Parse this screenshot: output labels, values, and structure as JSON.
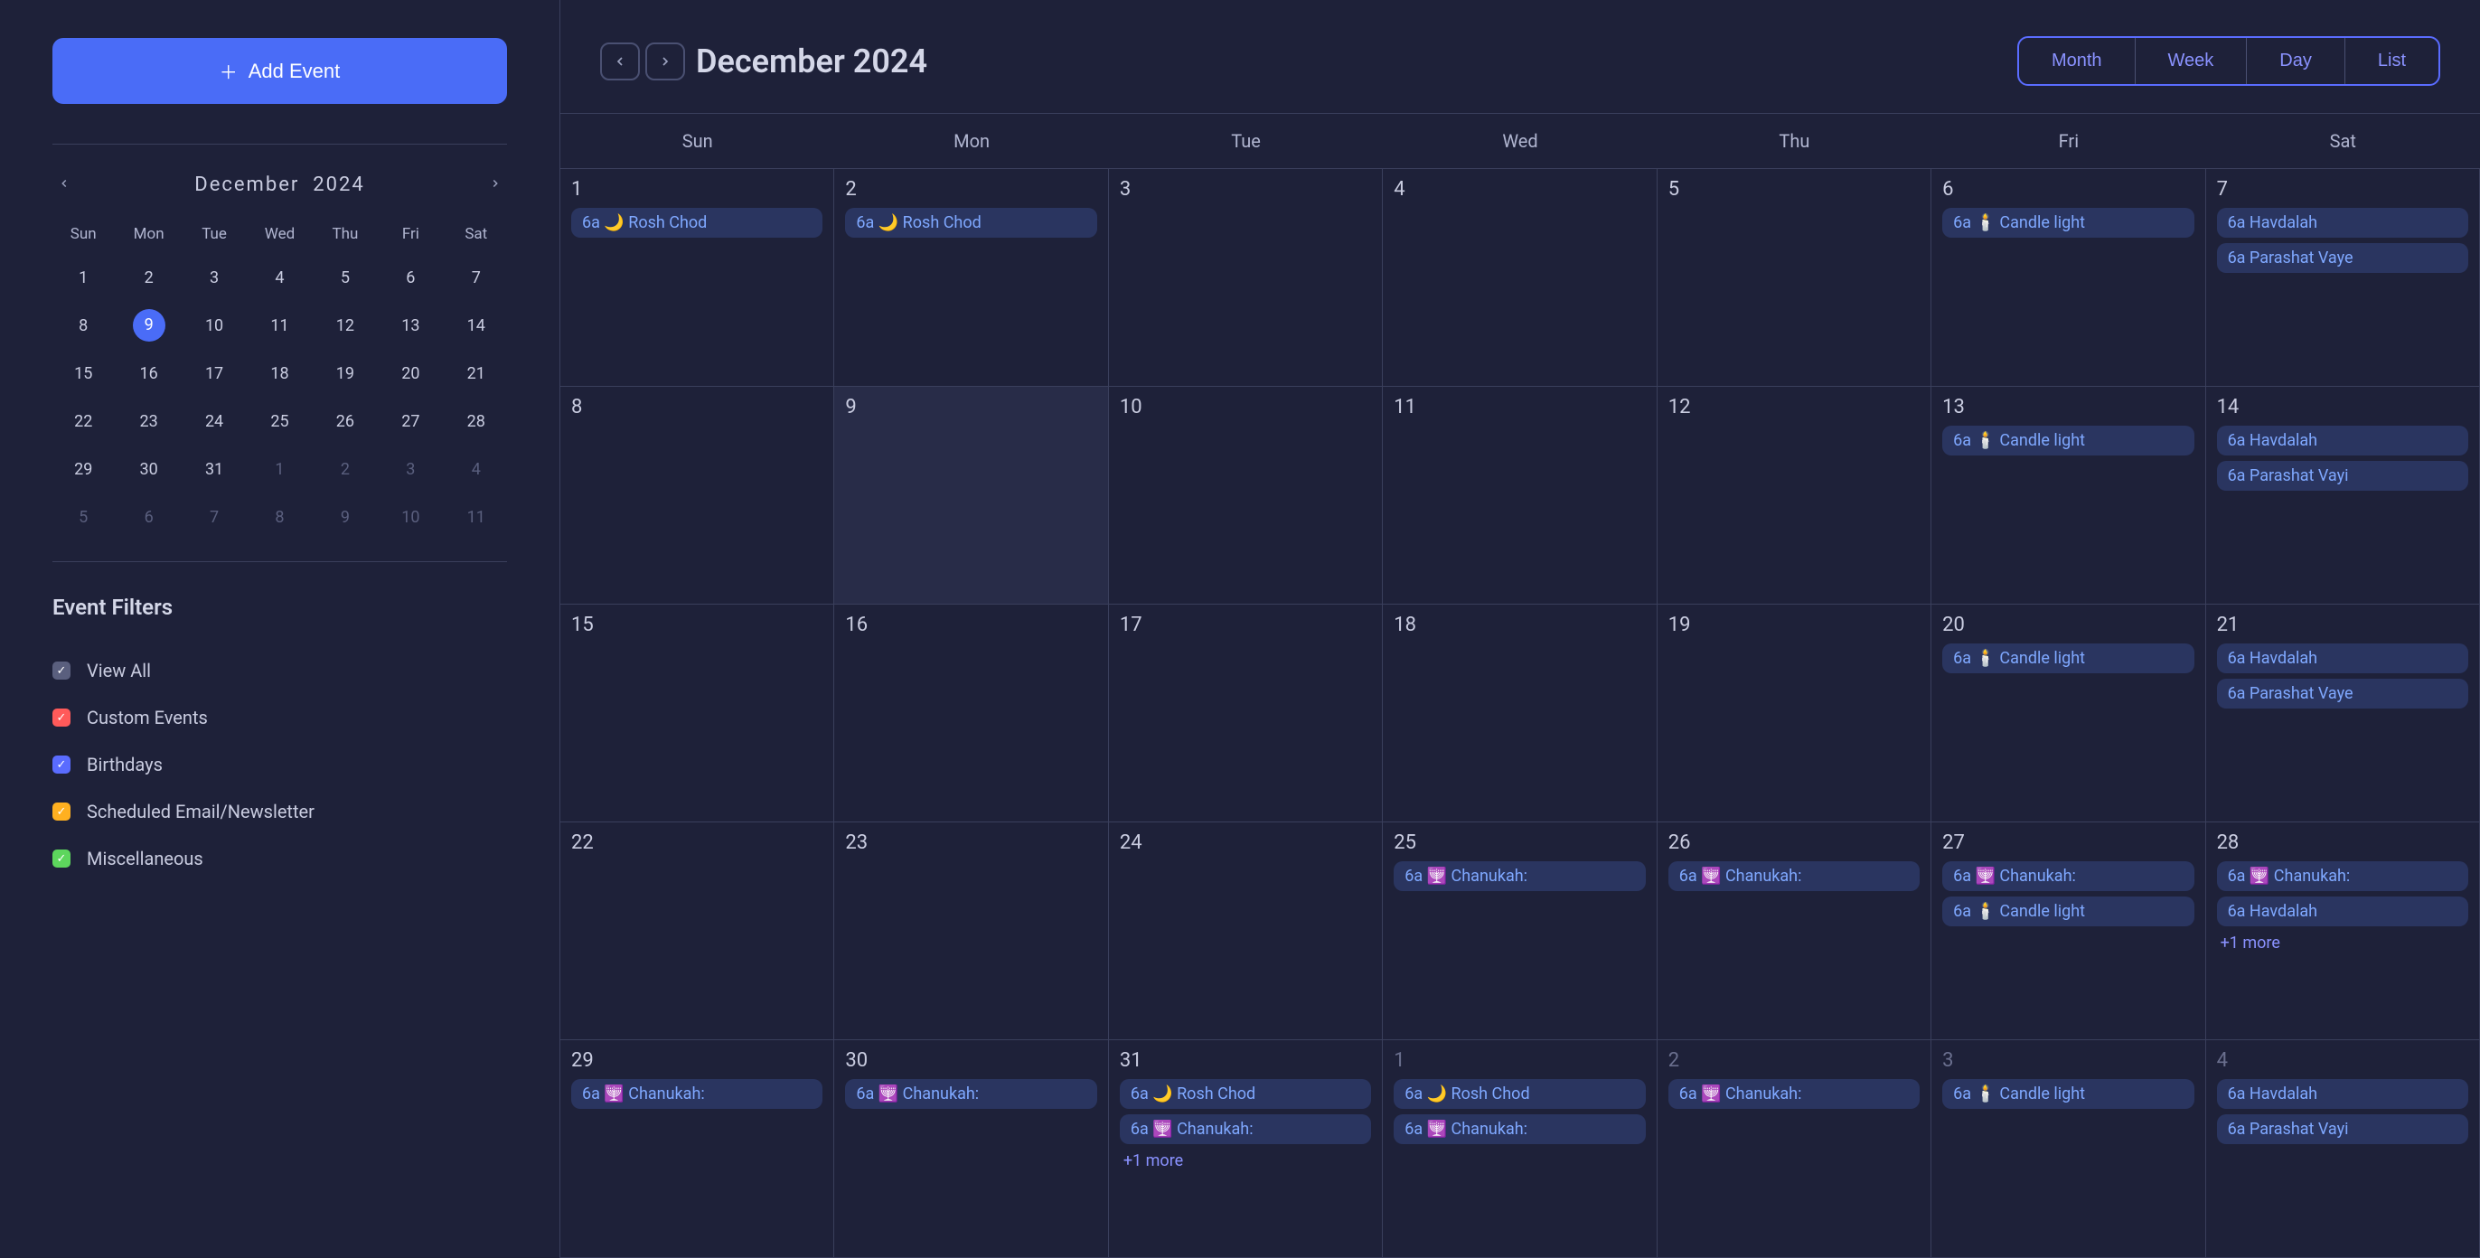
{
  "add_event_label": "Add Event",
  "mini": {
    "month_label": "December",
    "year_label": "2024",
    "dow": [
      "Sun",
      "Mon",
      "Tue",
      "Wed",
      "Thu",
      "Fri",
      "Sat"
    ],
    "days": [
      {
        "n": "1"
      },
      {
        "n": "2"
      },
      {
        "n": "3"
      },
      {
        "n": "4"
      },
      {
        "n": "5"
      },
      {
        "n": "6"
      },
      {
        "n": "7"
      },
      {
        "n": "8"
      },
      {
        "n": "9",
        "today": true
      },
      {
        "n": "10"
      },
      {
        "n": "11"
      },
      {
        "n": "12"
      },
      {
        "n": "13"
      },
      {
        "n": "14"
      },
      {
        "n": "15"
      },
      {
        "n": "16"
      },
      {
        "n": "17"
      },
      {
        "n": "18"
      },
      {
        "n": "19"
      },
      {
        "n": "20"
      },
      {
        "n": "21"
      },
      {
        "n": "22"
      },
      {
        "n": "23"
      },
      {
        "n": "24"
      },
      {
        "n": "25"
      },
      {
        "n": "26"
      },
      {
        "n": "27"
      },
      {
        "n": "28"
      },
      {
        "n": "29"
      },
      {
        "n": "30"
      },
      {
        "n": "31"
      },
      {
        "n": "1",
        "dim": true
      },
      {
        "n": "2",
        "dim": true
      },
      {
        "n": "3",
        "dim": true
      },
      {
        "n": "4",
        "dim": true
      },
      {
        "n": "5",
        "dim": true
      },
      {
        "n": "6",
        "dim": true
      },
      {
        "n": "7",
        "dim": true
      },
      {
        "n": "8",
        "dim": true
      },
      {
        "n": "9",
        "dim": true
      },
      {
        "n": "10",
        "dim": true
      },
      {
        "n": "11",
        "dim": true
      }
    ]
  },
  "filters": {
    "title": "Event Filters",
    "items": [
      {
        "label": "View All",
        "color": "grey"
      },
      {
        "label": "Custom Events",
        "color": "red"
      },
      {
        "label": "Birthdays",
        "color": "blue"
      },
      {
        "label": "Scheduled Email/Newsletter",
        "color": "yellow"
      },
      {
        "label": "Miscellaneous",
        "color": "green"
      }
    ]
  },
  "header": {
    "title": "December 2024",
    "views": [
      "Month",
      "Week",
      "Day",
      "List"
    ]
  },
  "dow": [
    "Sun",
    "Mon",
    "Tue",
    "Wed",
    "Thu",
    "Fri",
    "Sat"
  ],
  "weeks": [
    [
      {
        "n": "1",
        "events": [
          "6a 🌙 Rosh Chod"
        ]
      },
      {
        "n": "2",
        "events": [
          "6a 🌙 Rosh Chod"
        ]
      },
      {
        "n": "3",
        "events": []
      },
      {
        "n": "4",
        "events": []
      },
      {
        "n": "5",
        "events": []
      },
      {
        "n": "6",
        "events": [
          "6a 🕯️ Candle light"
        ]
      },
      {
        "n": "7",
        "events": [
          "6a Havdalah",
          "6a Parashat Vaye"
        ]
      }
    ],
    [
      {
        "n": "8",
        "events": []
      },
      {
        "n": "9",
        "today": true,
        "events": []
      },
      {
        "n": "10",
        "events": []
      },
      {
        "n": "11",
        "events": []
      },
      {
        "n": "12",
        "events": []
      },
      {
        "n": "13",
        "events": [
          "6a 🕯️ Candle light"
        ]
      },
      {
        "n": "14",
        "events": [
          "6a Havdalah",
          "6a Parashat Vayi"
        ]
      }
    ],
    [
      {
        "n": "15",
        "events": []
      },
      {
        "n": "16",
        "events": []
      },
      {
        "n": "17",
        "events": []
      },
      {
        "n": "18",
        "events": []
      },
      {
        "n": "19",
        "events": []
      },
      {
        "n": "20",
        "events": [
          "6a 🕯️ Candle light"
        ]
      },
      {
        "n": "21",
        "events": [
          "6a Havdalah",
          "6a Parashat Vaye"
        ]
      }
    ],
    [
      {
        "n": "22",
        "events": []
      },
      {
        "n": "23",
        "events": []
      },
      {
        "n": "24",
        "events": []
      },
      {
        "n": "25",
        "events": [
          "6a 🕎 Chanukah:"
        ]
      },
      {
        "n": "26",
        "events": [
          "6a 🕎 Chanukah:"
        ]
      },
      {
        "n": "27",
        "events": [
          "6a 🕎 Chanukah:",
          "6a 🕯️ Candle light"
        ]
      },
      {
        "n": "28",
        "events": [
          "6a 🕎 Chanukah:",
          "6a Havdalah"
        ],
        "more": "+1 more"
      }
    ],
    [
      {
        "n": "29",
        "events": [
          "6a 🕎 Chanukah:"
        ]
      },
      {
        "n": "30",
        "events": [
          "6a 🕎 Chanukah:"
        ]
      },
      {
        "n": "31",
        "events": [
          "6a 🌙 Rosh Chod",
          "6a 🕎 Chanukah:"
        ],
        "more": "+1 more"
      },
      {
        "n": "1",
        "out": true,
        "events": [
          "6a 🌙 Rosh Chod",
          "6a 🕎 Chanukah:"
        ]
      },
      {
        "n": "2",
        "out": true,
        "events": [
          "6a 🕎 Chanukah:"
        ]
      },
      {
        "n": "3",
        "out": true,
        "events": [
          "6a 🕯️ Candle light"
        ]
      },
      {
        "n": "4",
        "out": true,
        "events": [
          "6a Havdalah",
          "6a Parashat Vayi"
        ]
      }
    ]
  ]
}
